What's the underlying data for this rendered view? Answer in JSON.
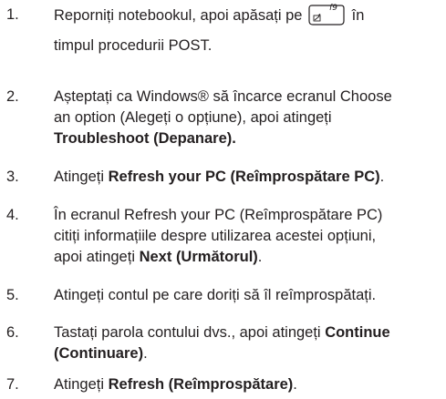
{
  "steps": [
    {
      "number": "1.",
      "line1_before": "Reporniți notebookul, apoi apăsați pe",
      "line1_after": "în",
      "line2": "timpul procedurii POST.",
      "key": {
        "icon": "f9-function-key",
        "label": "f9"
      }
    },
    {
      "number": "2.",
      "line1": "Așteptați ca Windows® să încarce ecranul Choose",
      "line2": "an option (Alegeți o opțiune), apoi atingeți",
      "line3_bold": "Troubleshoot (Depanare)."
    },
    {
      "number": "3.",
      "before": "Atingeți",
      "bold": "Refresh your PC (Reîmprospătare PC)",
      "after": "."
    },
    {
      "number": "4.",
      "line1": "În ecranul Refresh your PC (Reîmprospătare PC)",
      "line2": "citiți informațiile despre utilizarea acestei opțiuni,",
      "line3_before": "apoi atingeți",
      "line3_bold": "Next (Următorul)",
      "line3_after": "."
    },
    {
      "number": "5.",
      "text": "Atingeți contul pe care doriți să îl reîmprospătați."
    },
    {
      "number": "6.",
      "line1_before": "Tastați parola contului dvs., apoi atingeți",
      "line1_bold": "Continue",
      "line2_bold": "(Continuare)",
      "line2_after": "."
    },
    {
      "number": "7.",
      "before": "Atingeți",
      "bold": "Refresh (Reîmprospătare)",
      "after": "."
    }
  ]
}
